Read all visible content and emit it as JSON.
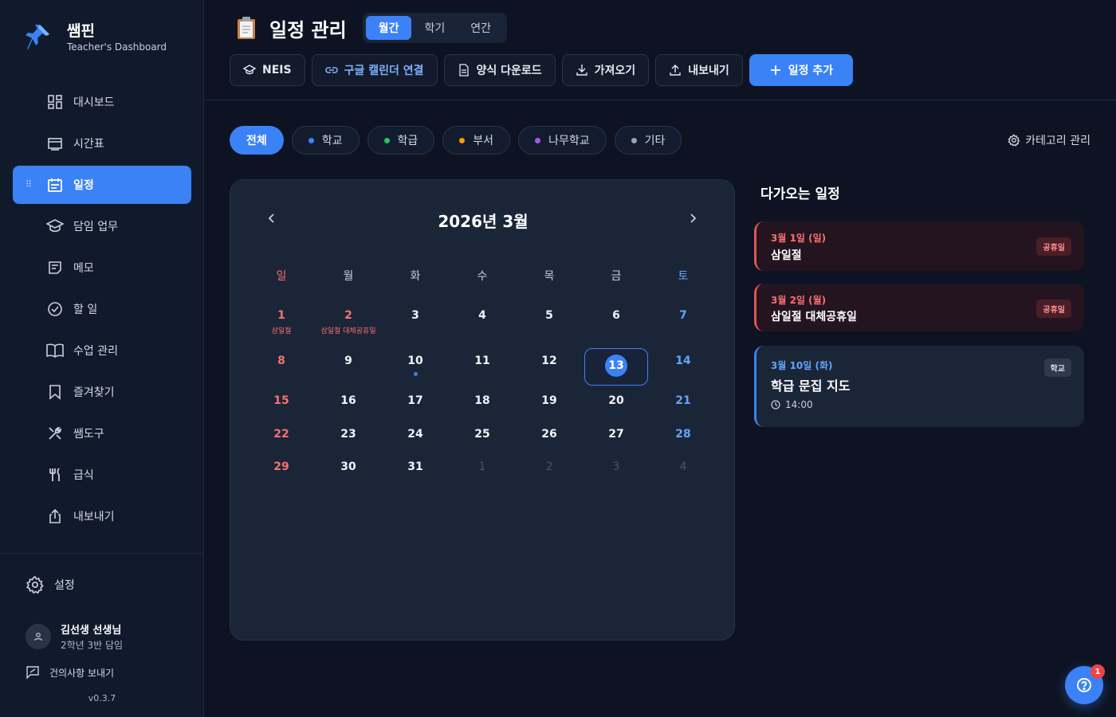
{
  "brand": {
    "title": "쌤핀",
    "subtitle": "Teacher's Dashboard"
  },
  "sidebar": {
    "items": [
      {
        "label": "대시보드",
        "icon": "dashboard-icon"
      },
      {
        "label": "시간표",
        "icon": "timetable-icon"
      },
      {
        "label": "일정",
        "icon": "calendar-icon",
        "active": true
      },
      {
        "label": "담임 업무",
        "icon": "graduation-cap-icon"
      },
      {
        "label": "메모",
        "icon": "memo-icon"
      },
      {
        "label": "할 일",
        "icon": "check-circle-icon"
      },
      {
        "label": "수업 관리",
        "icon": "book-icon"
      },
      {
        "label": "즐겨찾기",
        "icon": "bookmark-icon"
      },
      {
        "label": "쌤도구",
        "icon": "tools-icon"
      },
      {
        "label": "급식",
        "icon": "utensils-icon"
      },
      {
        "label": "내보내기",
        "icon": "share-icon"
      }
    ],
    "settings": "설정",
    "user": {
      "name": "김선생 선생님",
      "role": "2학년 3반 담임"
    },
    "feedback": "건의사항 보내기",
    "version": "v0.3.7"
  },
  "header": {
    "title": "일정 관리",
    "view_tabs": [
      {
        "label": "월간",
        "active": true
      },
      {
        "label": "학기"
      },
      {
        "label": "연간"
      }
    ],
    "toolbar": {
      "neis": "NEIS",
      "google": "구글 캘린더 연결",
      "template": "양식 다운로드",
      "import": "가져오기",
      "export": "내보내기",
      "add": "일정 추가"
    }
  },
  "filters": {
    "chips": [
      {
        "label": "전체",
        "active": true
      },
      {
        "label": "학교",
        "color": "#3b82f6"
      },
      {
        "label": "학급",
        "color": "#22c55e"
      },
      {
        "label": "부서",
        "color": "#f59e0b"
      },
      {
        "label": "나무학교",
        "color": "#a855f7"
      },
      {
        "label": "기타",
        "color": "#9ca3af"
      }
    ],
    "manage": "카테고리 관리"
  },
  "calendar": {
    "title": "2026년 3월",
    "weekdays": [
      "일",
      "월",
      "화",
      "수",
      "목",
      "금",
      "토"
    ],
    "weeks": [
      [
        {
          "d": "1",
          "hol": "삼일절"
        },
        {
          "d": "2",
          "hol": "삼일절 대체공휴일",
          "red": true
        },
        {
          "d": "3"
        },
        {
          "d": "4"
        },
        {
          "d": "5"
        },
        {
          "d": "6"
        },
        {
          "d": "7"
        }
      ],
      [
        {
          "d": "8"
        },
        {
          "d": "9"
        },
        {
          "d": "10",
          "dot": true
        },
        {
          "d": "11"
        },
        {
          "d": "12"
        },
        {
          "d": "13",
          "today": true
        },
        {
          "d": "14"
        }
      ],
      [
        {
          "d": "15"
        },
        {
          "d": "16"
        },
        {
          "d": "17"
        },
        {
          "d": "18"
        },
        {
          "d": "19"
        },
        {
          "d": "20"
        },
        {
          "d": "21"
        }
      ],
      [
        {
          "d": "22"
        },
        {
          "d": "23"
        },
        {
          "d": "24"
        },
        {
          "d": "25"
        },
        {
          "d": "26"
        },
        {
          "d": "27"
        },
        {
          "d": "28"
        }
      ],
      [
        {
          "d": "29"
        },
        {
          "d": "30"
        },
        {
          "d": "31"
        },
        {
          "d": "1",
          "muted": true
        },
        {
          "d": "2",
          "muted": true
        },
        {
          "d": "3",
          "muted": true
        },
        {
          "d": "4",
          "muted": true
        }
      ]
    ]
  },
  "upcoming": {
    "title": "다가오는 일정",
    "events": [
      {
        "date": "3월 1일 (일)",
        "name": "삼일절",
        "tag": "공휴일",
        "kind": "red"
      },
      {
        "date": "3월 2일 (월)",
        "name": "삼일절 대체공휴일",
        "tag": "공휴일",
        "kind": "red"
      },
      {
        "date": "3월 10일 (화)",
        "name": "학급 문집 지도",
        "tag": "학교",
        "kind": "blue",
        "time": "14:00"
      }
    ]
  },
  "help": {
    "badge": "1"
  }
}
